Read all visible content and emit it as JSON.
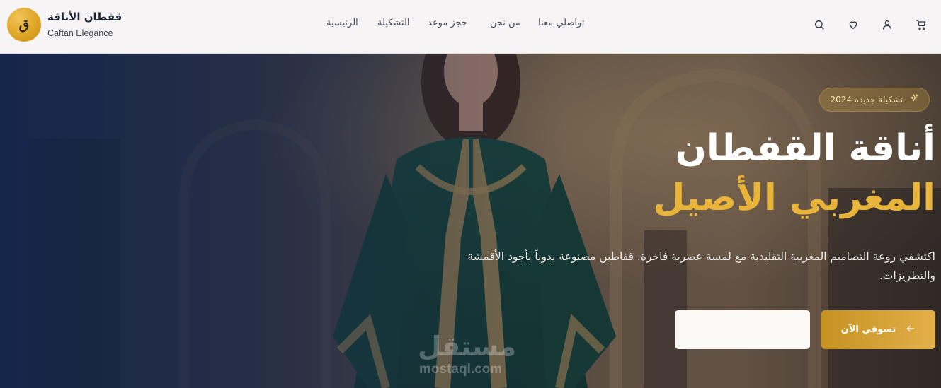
{
  "brand": {
    "logo_letter": "ق",
    "name_ar": "قفطان الأناقة",
    "name_en": "Caftan Elegance"
  },
  "nav": {
    "items": [
      {
        "label": "الرئيسية"
      },
      {
        "label": "التشكيلة"
      },
      {
        "label": "حجز موعد"
      },
      {
        "label": "من نحن"
      },
      {
        "label": "تواصلي معنا"
      }
    ]
  },
  "header_icons": [
    "search-icon",
    "heart-icon",
    "user-icon",
    "cart-icon"
  ],
  "hero": {
    "badge": "تشكيلة جديدة 2024",
    "title_line1": "أناقة القفطان",
    "title_line2": "المغربي الأصيل",
    "description": "اكتشفي روعة التصاميم المغربية التقليدية مع لمسة عصرية فاخرة. قفاطين مصنوعة يدوياً بأجود الأقمشة والتطريزات.",
    "cta_label": "تسوقي الآن",
    "secondary_button_label": ""
  },
  "watermark": {
    "text_ar": "مستقل",
    "text_en": "mostaql.com"
  },
  "colors": {
    "accent_gold": "#e8b53a",
    "header_bg": "#f6f4f4",
    "caftan_green": "#0f4a3c"
  }
}
